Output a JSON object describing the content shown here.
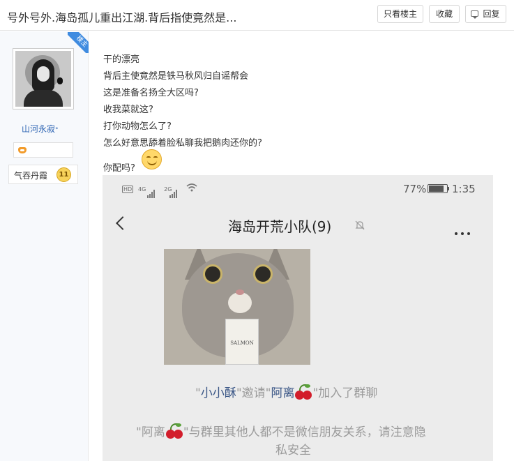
{
  "header": {
    "thread_title": "号外号外.海岛孤儿重出江湖.背后指使竟然是...",
    "only_op_label": "只看楼主",
    "collect_label": "收藏",
    "reply_label": "回复"
  },
  "user": {
    "op_badge": "楼主",
    "name": "山河永寂",
    "name_mark": "°",
    "rank_name": "气吞丹霞",
    "rank_level": "11"
  },
  "post": {
    "lines": [
      "干的漂亮",
      "背后主使竟然是铁马秋风归自谣帮会",
      "这是准备名扬全大区吗?",
      "收我菜就这?",
      "打你动物怎么了?",
      "怎么好意思舔着脸私聊我把鹅肉还你的?",
      "你配吗?"
    ]
  },
  "screenshot": {
    "network_label": "HD",
    "sim1": "4G",
    "sim2": "2G",
    "battery": "77%",
    "time": "1:35",
    "group_title": "海岛开荒小队(9)",
    "bottle_text": "SALMON",
    "invite_q1": "\"",
    "invite_name1": "小小酥",
    "invite_mid": "\"邀请\"",
    "invite_name2": "阿离",
    "invite_tail": "\"加入了群聊",
    "warn_q1": "\"阿离",
    "warn_tail": "\"与群里其他人都不是微信朋友关系，请注意隐",
    "warn_line2": "私安全"
  }
}
